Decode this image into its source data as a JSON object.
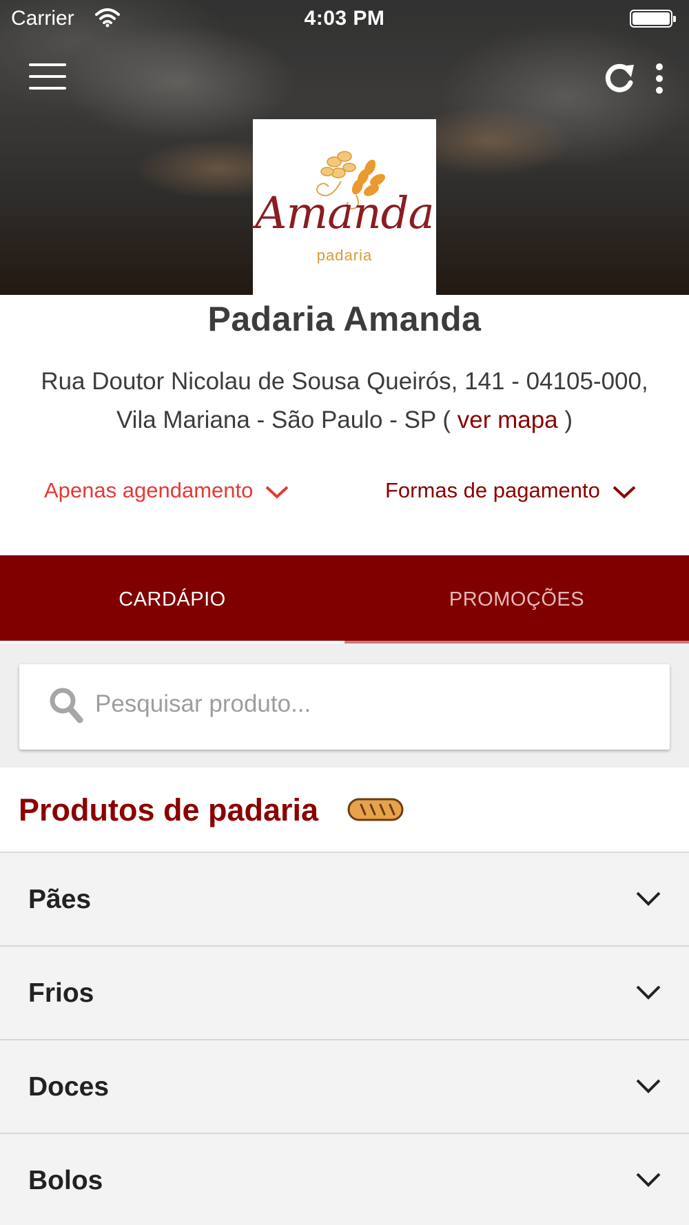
{
  "status_bar": {
    "carrier": "Carrier",
    "time": "4:03 PM"
  },
  "header": {
    "icons": [
      "menu-icon",
      "refresh-icon",
      "more-vertical-icon"
    ]
  },
  "logo": {
    "name": "Amanda",
    "subtitle": "padaria"
  },
  "store": {
    "name": "Padaria Amanda",
    "address_line1": "Rua Doutor Nicolau de Sousa Queirós, 141 - 04105-000,",
    "address_line2": "Vila Mariana - São Paulo - SP ( ",
    "map_link": "ver mapa",
    "address_close": " )"
  },
  "dropdowns": {
    "schedule": "Apenas agendamento",
    "payment": "Formas de pagamento"
  },
  "tabs": [
    {
      "label": "CARDÁPIO",
      "active": true
    },
    {
      "label": "PROMOÇÕES",
      "active": false
    }
  ],
  "search": {
    "placeholder": "Pesquisar produto...",
    "value": ""
  },
  "section": {
    "title": "Produtos de padaria",
    "icon": "bread-icon"
  },
  "categories": [
    {
      "label": "Pães"
    },
    {
      "label": "Frios"
    },
    {
      "label": "Doces"
    },
    {
      "label": "Bolos"
    }
  ],
  "colors": {
    "brand": "#800000",
    "accent_red": "#e53935",
    "link": "#8b0000"
  }
}
